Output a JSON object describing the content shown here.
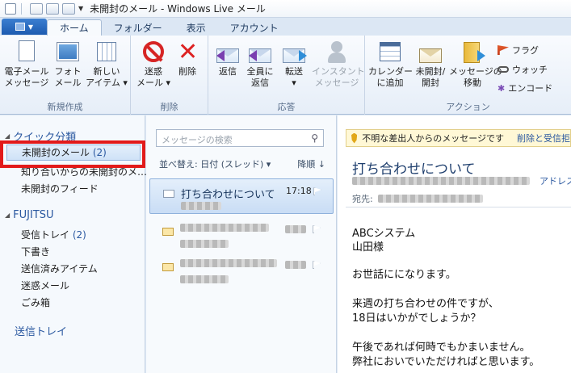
{
  "window": {
    "title": "未開封のメール - Windows Live メール"
  },
  "tabs": [
    "ホーム",
    "フォルダー",
    "表示",
    "アカウント"
  ],
  "ribbon": {
    "groups": {
      "new": "新規作成",
      "delete": "削除",
      "respond": "応答",
      "actions": "アクション"
    },
    "buttons": {
      "email_message": [
        "電子メール",
        "メッセージ"
      ],
      "photo_email": [
        "フォト",
        "メール"
      ],
      "new_items": [
        "新しい",
        "アイテム ▾"
      ],
      "junk": [
        "迷惑",
        "メール ▾"
      ],
      "delete": [
        "削除"
      ],
      "reply": [
        "返信"
      ],
      "reply_all": [
        "全員に",
        "返信"
      ],
      "forward": [
        "転送",
        "▾"
      ],
      "instant_message": [
        "インスタント",
        "メッセージ"
      ],
      "add_calendar": [
        "カレンダー",
        "に追加"
      ],
      "unread_read": [
        "未開封/",
        "開封"
      ],
      "move_to": [
        "メッセージの",
        "移動"
      ],
      "flag": "フラグ",
      "watch": "ウォッチ",
      "encode": "エンコード"
    }
  },
  "nav": {
    "quick_views": "クイック分類",
    "quick_items": [
      {
        "label": "未開封のメール",
        "count": "(2)"
      },
      {
        "label": "知り合いからの未開封のメ…"
      },
      {
        "label": "未開封のフィード"
      }
    ],
    "account": "FUJITSU",
    "folders": [
      {
        "label": "受信トレイ",
        "count": "(2)"
      },
      {
        "label": "下書き"
      },
      {
        "label": "送信済みアイテム"
      },
      {
        "label": "迷惑メール"
      },
      {
        "label": "ごみ箱"
      }
    ],
    "outbox": "送信トレイ"
  },
  "list": {
    "search_placeholder": "メッセージの検索",
    "sort_label": "並べ替え: 日付 (スレッド) ▾",
    "sort_order": "降順 ↓",
    "messages": [
      {
        "subject": "打ち合わせについて",
        "time": "17:18"
      }
    ]
  },
  "reading": {
    "warning": "不明な差出人からのメッセージです",
    "warning_link": "削除と受信拒",
    "subject": "打ち合わせについて",
    "address_link": "アドレス",
    "to_label": "宛先:",
    "body": [
      "ABCシステム",
      "山田様",
      "",
      "お世話にになります。",
      "",
      "来週の打ち合わせの件ですが、",
      "18日はいかがでしょうか？",
      "",
      "午後であれば何時でもかまいません。",
      "弊社においでいただければと思います。"
    ]
  }
}
